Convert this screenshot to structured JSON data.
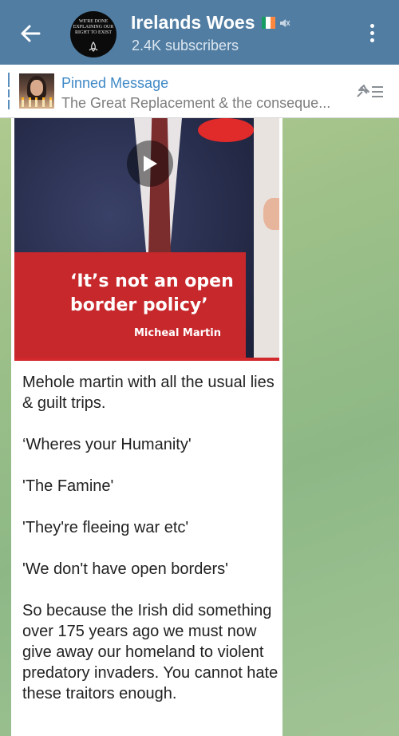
{
  "header": {
    "channel_title": "Irelands Woes",
    "subscribers": "2.4K subscribers",
    "avatar_text": "WE'RE DONE\nEXPLAINING OUR\nRIGHT TO EXIST",
    "flag_colors": [
      "#169b62",
      "#ffffff",
      "#ff883e"
    ]
  },
  "pinned": {
    "label": "Pinned Message",
    "text": "The Great Replacement & the conseque..."
  },
  "media": {
    "quote": "‘It’s not an open border policy’",
    "speaker": "Micheal Martin"
  },
  "message": {
    "text": "Mehole martin with all the usual lies & guilt trips.\n\n‘Wheres your Humanity'\n\n'The Famine'\n\n'They're fleeing war etc'\n\n'We don't have open borders'\n\nSo because the Irish did something over 175 years ago we must now give away our homeland to violent predatory invaders. You cannot hate these traitors enough."
  },
  "icons": {
    "back": "arrow-left-icon",
    "muted": "speaker-muted-icon",
    "menu": "more-vertical-icon",
    "pinned_list": "pin-list-icon",
    "play": "play-icon"
  }
}
